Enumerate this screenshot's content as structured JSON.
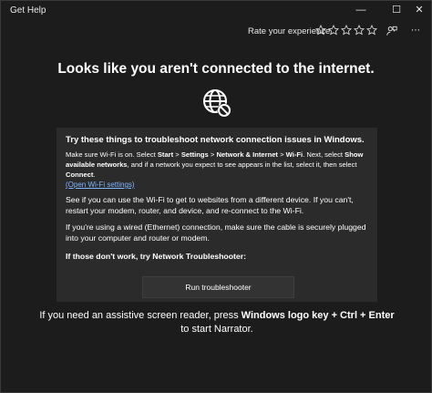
{
  "window": {
    "app_title": "Get Help",
    "minimize": "—",
    "maximize": "☐",
    "close": "✕"
  },
  "toolbar": {
    "rate_label": "Rate your experience",
    "star_count": 5
  },
  "main": {
    "headline": "Looks like you aren't connected to the internet."
  },
  "panel": {
    "title": "Try these things to troubleshoot network connection issues in Windows.",
    "step1_a": "Make sure Wi-Fi is on. Select ",
    "step1_start": "Start",
    "step1_sep1": " > ",
    "step1_settings": "Settings",
    "step1_sep2": " > ",
    "step1_network": "Network & Internet",
    "step1_sep3": " > ",
    "step1_wifi": "Wi-Fi",
    "step1_b": ". Next, select ",
    "step1_show": "Show available networks",
    "step1_c": ", and if a network you expect to see appears in the list, select it, then select ",
    "step1_connect": "Connect",
    "step1_d": ".",
    "wifi_link": "(Open Wi-Fi settings)",
    "step2": "See if you can use the Wi-Fi to get to websites from a different device. If you can't, restart your modem, router, and device, and re-connect to the Wi-Fi.",
    "step3": "If you're using a wired (Ethernet) connection, make sure the cable is securely plugged into your computer and router or modem.",
    "step4": "If those don't work, try Network Troubleshooter:",
    "button_label": "Run troubleshooter"
  },
  "footer": {
    "a": "If you need an assistive screen reader, press ",
    "keys": "Windows logo key + Ctrl + Enter",
    "b": " to start Narrator."
  }
}
